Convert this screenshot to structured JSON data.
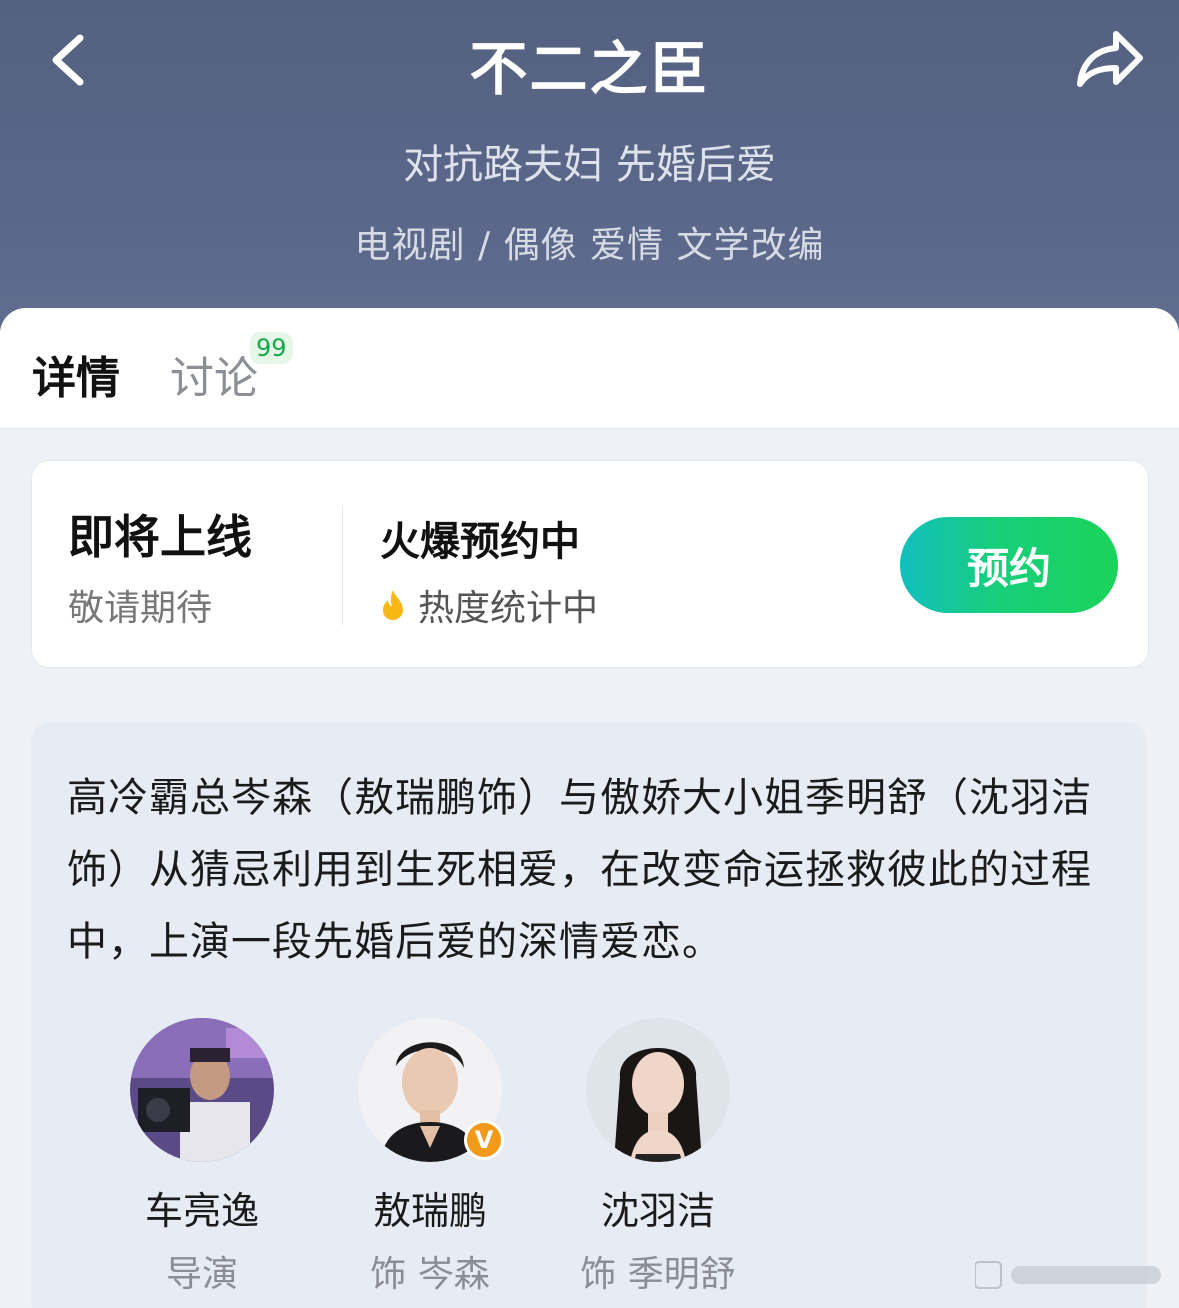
{
  "header": {
    "title": "不二之臣",
    "subtitle": "对抗路夫妇 先婚后爱",
    "meta": "电视剧 / 偶像 爱情 文学改编",
    "back_icon": "chevron-left-icon",
    "share_icon": "share-icon"
  },
  "tabs": [
    {
      "label": "详情",
      "active": true
    },
    {
      "label": "讨论",
      "badge": "99",
      "active": false
    }
  ],
  "release": {
    "status": "即将上线",
    "status_sub": "敬请期待",
    "hot_title": "火爆预约中",
    "heat_text": "热度统计中",
    "heat_icon": "flame-icon",
    "button_label": "预约",
    "accent_colors": [
      "#12bfbe",
      "#1bd35a"
    ]
  },
  "synopsis": "高冷霸总岑森（敖瑞鹏饰）与傲娇大小姐季明舒（沈羽洁饰）从猜忌利用到生死相爱，在改变命运拯救彼此的过程中，上演一段先婚后爱的深情爱恋。",
  "cast": [
    {
      "name": "车亮逸",
      "role": "导演",
      "verified": false
    },
    {
      "name": "敖瑞鹏",
      "role": "饰 岑森",
      "verified": true,
      "verified_label": "V"
    },
    {
      "name": "沈羽洁",
      "role": "饰 季明舒",
      "verified": false
    }
  ]
}
